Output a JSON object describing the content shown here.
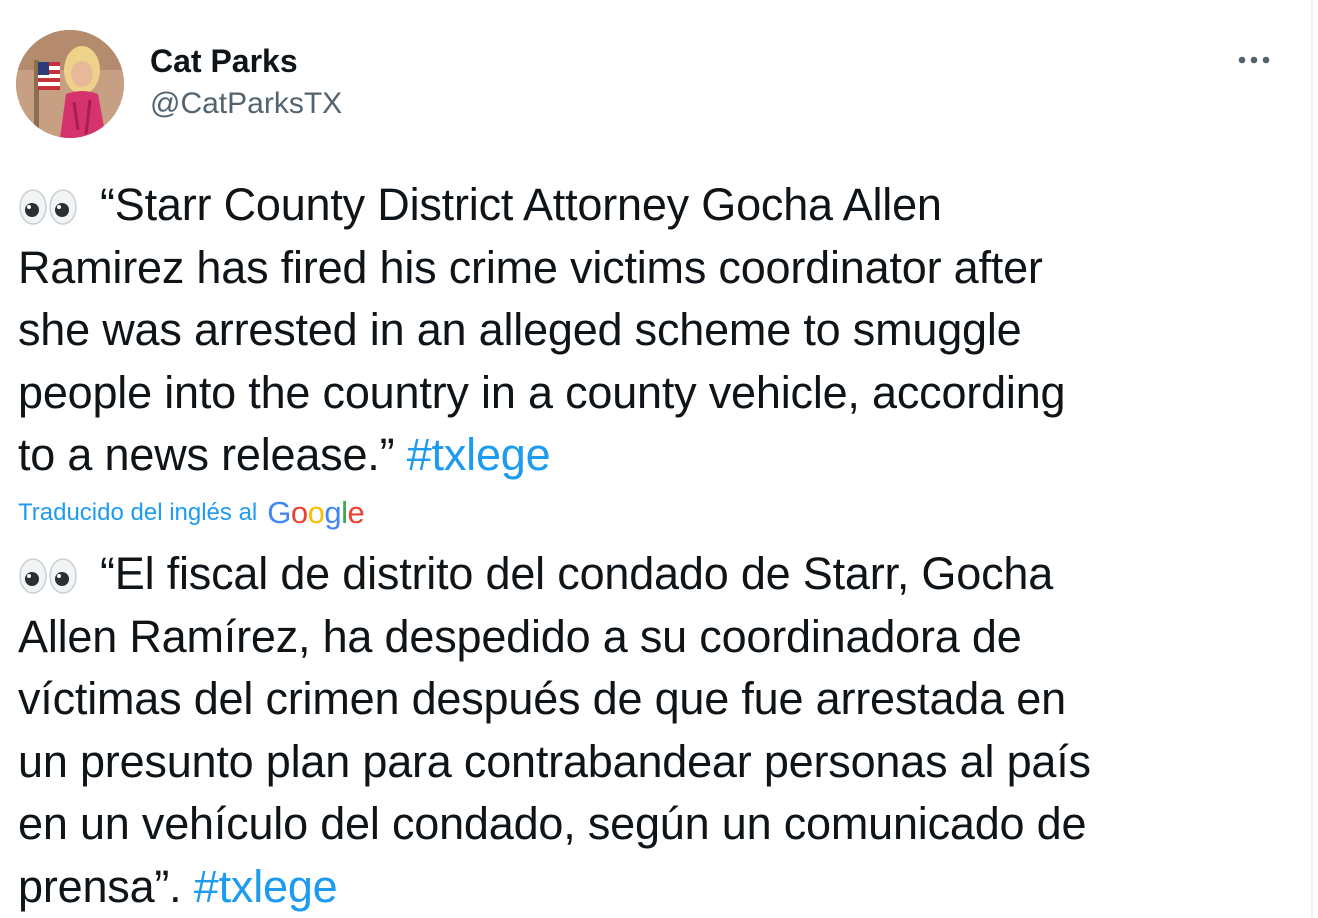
{
  "author": {
    "name": "Cat Parks",
    "handle": "@CatParksTX"
  },
  "icons": {
    "avatar": "profile-photo",
    "more": "more-options-icon",
    "emoji": "eyes-emoji"
  },
  "tweet": {
    "lines": [
      "“Starr County District Attorney Gocha Allen",
      "Ramirez has fired his crime victims coordinator after",
      "she was arrested in an alleged scheme to smuggle",
      "people into the country in a county vehicle, according",
      "to a news release.”"
    ],
    "hashtag": "#txlege"
  },
  "translation": {
    "label": "Traducido del inglés al",
    "provider": "Google",
    "lines": [
      "“El fiscal de distrito del condado de Starr, Gocha",
      "Allen Ramírez, ha despedido a su coordinadora de",
      "víctimas del crimen después de que fue arrestada en",
      "un presunto plan para contrabandear personas al país",
      "en un vehículo del condado, según un comunicado de",
      "prensa”."
    ],
    "hashtag": "#txlege"
  },
  "colors": {
    "link": "#1d9bf0",
    "secondary_text": "#536471",
    "google": [
      "#4285F4",
      "#EA4335",
      "#FBBC05",
      "#4285F4",
      "#34A853",
      "#EA4335"
    ]
  }
}
